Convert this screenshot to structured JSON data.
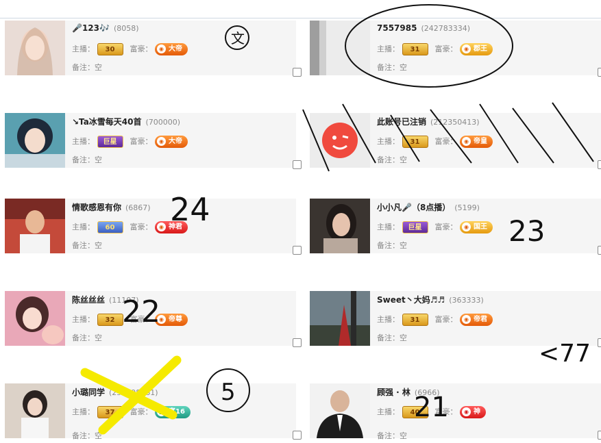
{
  "labels": {
    "anchor": "主播：",
    "rich": "富豪：",
    "note": "备注："
  },
  "cards": [
    {
      "name": "🎤123🎶",
      "uid": "(8058)",
      "anchor_level": "30",
      "rich_rank": "大帝",
      "note": "空"
    },
    {
      "name": "7557985",
      "uid": "(242783334)",
      "anchor_level": "31",
      "rich_rank": "郡王",
      "note": "空"
    },
    {
      "name": "↘Ta冰雪每天40首",
      "uid": "(700000)",
      "anchor_level": "巨星",
      "rich_rank": "大帝",
      "note": "空"
    },
    {
      "name": "此账号已注销",
      "uid": "(212350413)",
      "anchor_level": "31",
      "rich_rank": "帝皇",
      "note": "空"
    },
    {
      "name": "情歌感恩有你",
      "uid": "(6867)",
      "anchor_level": "60",
      "rich_rank": "神君",
      "note": "空"
    },
    {
      "name": "小小凡🎤（8点播）",
      "uid": "(5199)",
      "anchor_level": "巨星",
      "rich_rank": "国王",
      "note": "空"
    },
    {
      "name": "陈丝丝丝",
      "uid": "(11107)",
      "anchor_level": "32",
      "rich_rank": "帝尊",
      "note": "空"
    },
    {
      "name": "Sweet丶大妈♬♬",
      "uid": "(363333)",
      "anchor_level": "31",
      "rich_rank": "帝君",
      "note": "空"
    },
    {
      "name": "小璐同学",
      "uid": "(250798361)",
      "anchor_level": "37",
      "rich_rank": "富16",
      "note": "空"
    },
    {
      "name": "顾强 · 林",
      "uid": "(6966)",
      "anchor_level": "40",
      "rich_rank": "神",
      "note": "空"
    }
  ],
  "annotations": {
    "a1": "文",
    "a2": "24",
    "a3": "23",
    "a4": "22",
    "a5": "5",
    "a6": "21",
    "a7": "<77"
  },
  "colors": {
    "card_bg": "#f5f5f5",
    "ink": "#111111",
    "highlight": "#f5ea00"
  }
}
